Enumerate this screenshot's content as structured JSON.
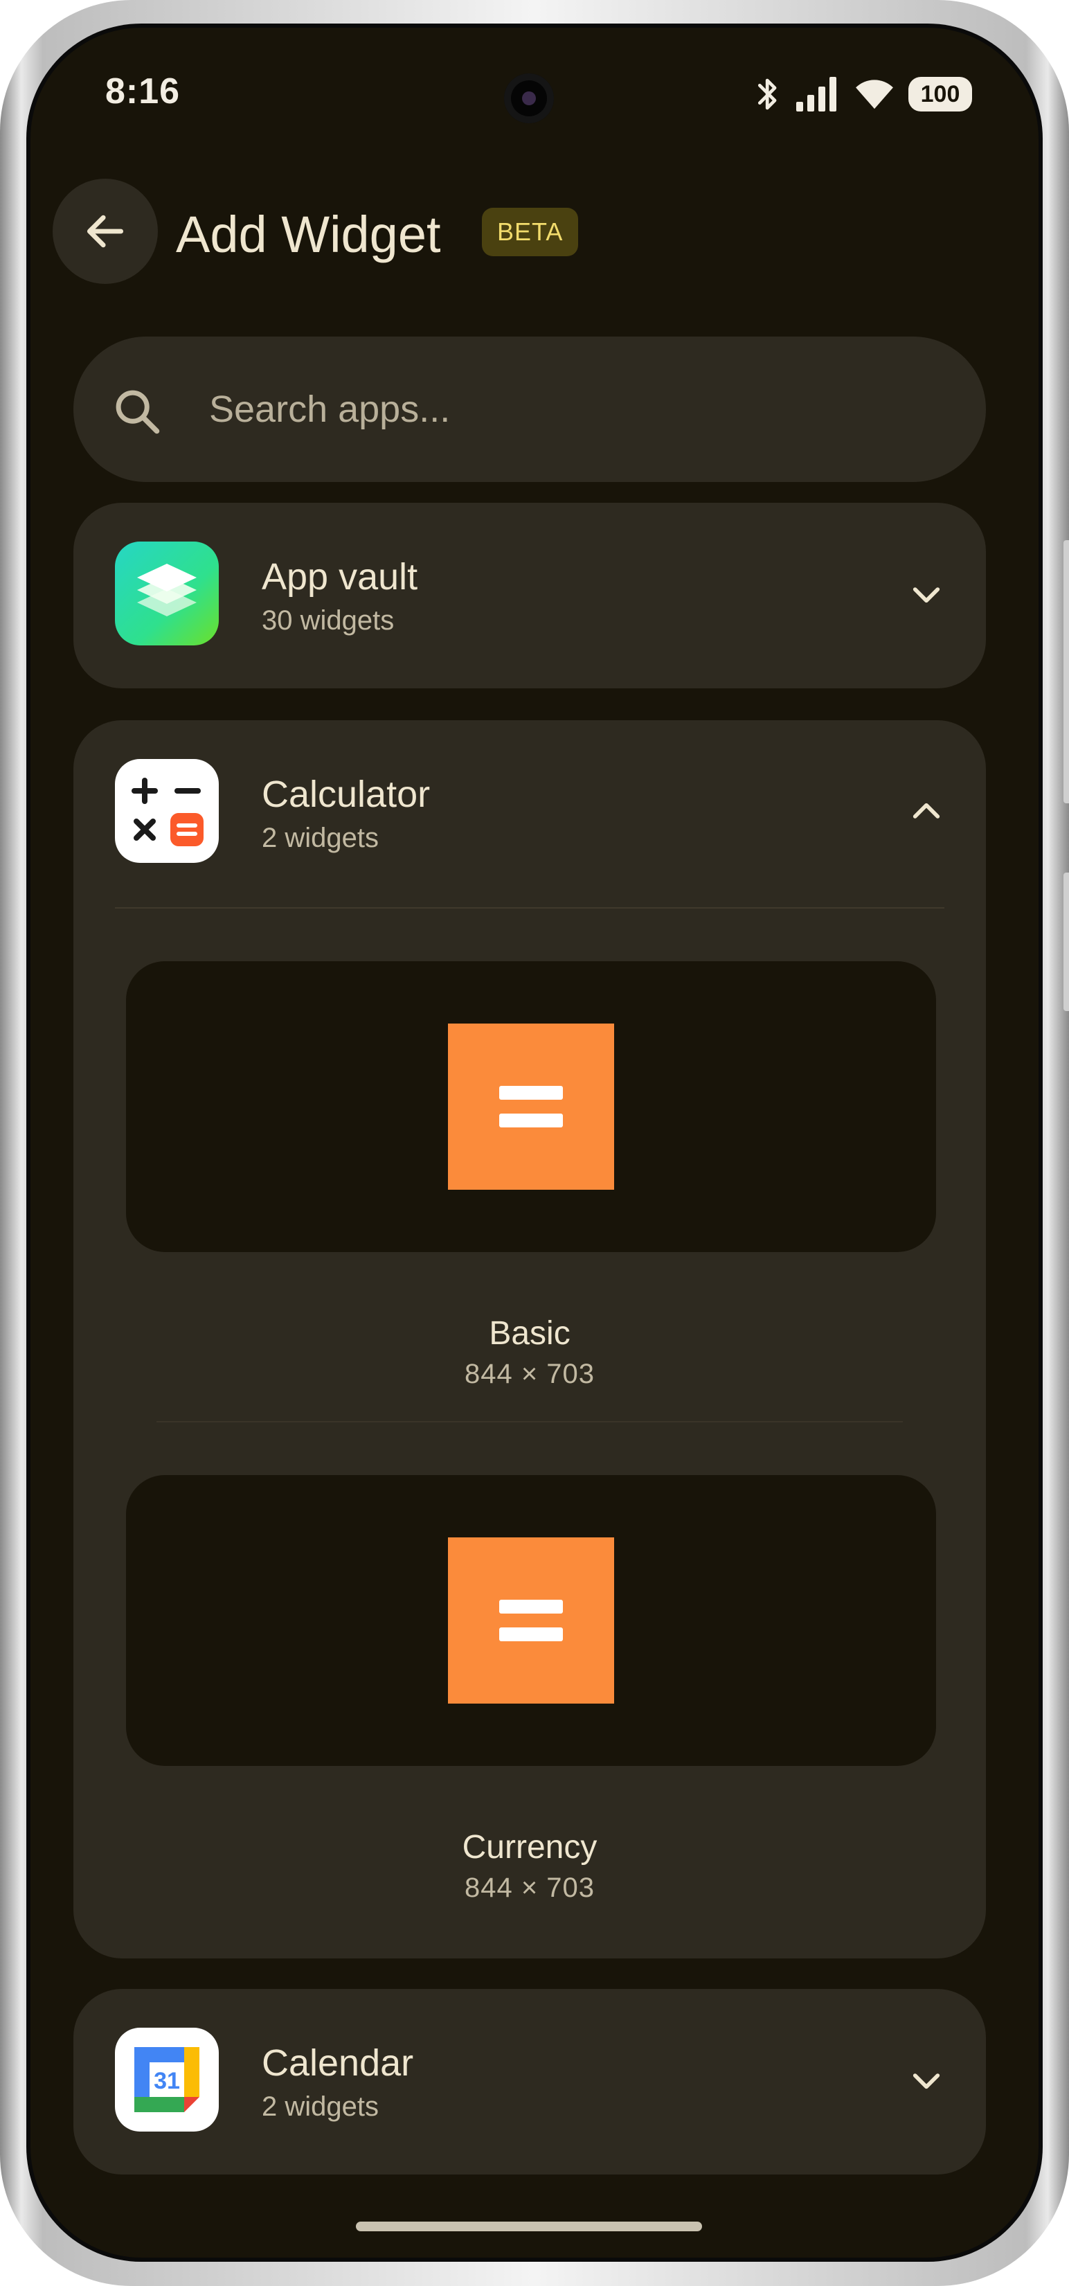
{
  "status_bar": {
    "time": "8:16",
    "battery": "100"
  },
  "header": {
    "title": "Add Widget",
    "badge": "BETA"
  },
  "search": {
    "placeholder": "Search apps..."
  },
  "apps": [
    {
      "name": "App vault",
      "subtitle": "30 widgets",
      "expanded": false,
      "icon": "layers-icon"
    },
    {
      "name": "Calculator",
      "subtitle": "2 widgets",
      "expanded": true,
      "icon": "calculator-icon",
      "widgets": [
        {
          "name": "Basic",
          "size": "844 × 703"
        },
        {
          "name": "Currency",
          "size": "844 × 703"
        }
      ]
    },
    {
      "name": "Calendar",
      "subtitle": "2 widgets",
      "expanded": false,
      "icon": "calendar-icon",
      "icon_text": "31"
    }
  ],
  "colors": {
    "background": "#181409",
    "card": "#2e2a20",
    "accent_orange": "#fb8b3b",
    "badge_bg": "#4a4110",
    "badge_text": "#f2dc6c"
  }
}
